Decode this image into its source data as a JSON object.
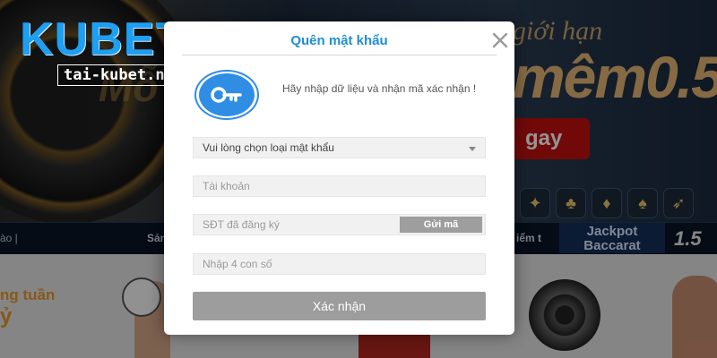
{
  "background": {
    "promo_line_1": "giới hạn",
    "promo_line_2": "mêm0.5",
    "promo_left": "Mỗ",
    "cta": "gay",
    "nav_left": "ào  |",
    "nav_middle": "Sản",
    "nav_right": "iểm t",
    "jackpot_line_1": "Jackpot",
    "jackpot_line_2": "Baccarat",
    "jackpot_amount": "1.5",
    "weekly_line_1": "ng tuần",
    "weekly_line_2": "ỷ"
  },
  "logo": {
    "brand": "KUBET",
    "url": "tai-kubet.net"
  },
  "modal": {
    "title": "Quên mật khẩu",
    "instruction": "Hãy nhập dữ liệu và nhận mã xác nhận !",
    "password_type_select": "Vui lòng chọn loại mật khẩu",
    "account_placeholder": "Tài khoản",
    "phone_placeholder": "SĐT đã đăng ký",
    "send_code_label": "Gửi mã",
    "code_placeholder": "Nhập 4 con số",
    "submit_label": "Xác nhận"
  },
  "colors": {
    "title_blue": "#1f8fd1",
    "key_icon_blue": "#2f8de4",
    "button_gray": "#9d9d9d",
    "logo_blue": "#1d9ff2"
  },
  "icons": {
    "close": "close-icon",
    "key": "key-icon",
    "dropdown": "chevron-down-icon"
  }
}
